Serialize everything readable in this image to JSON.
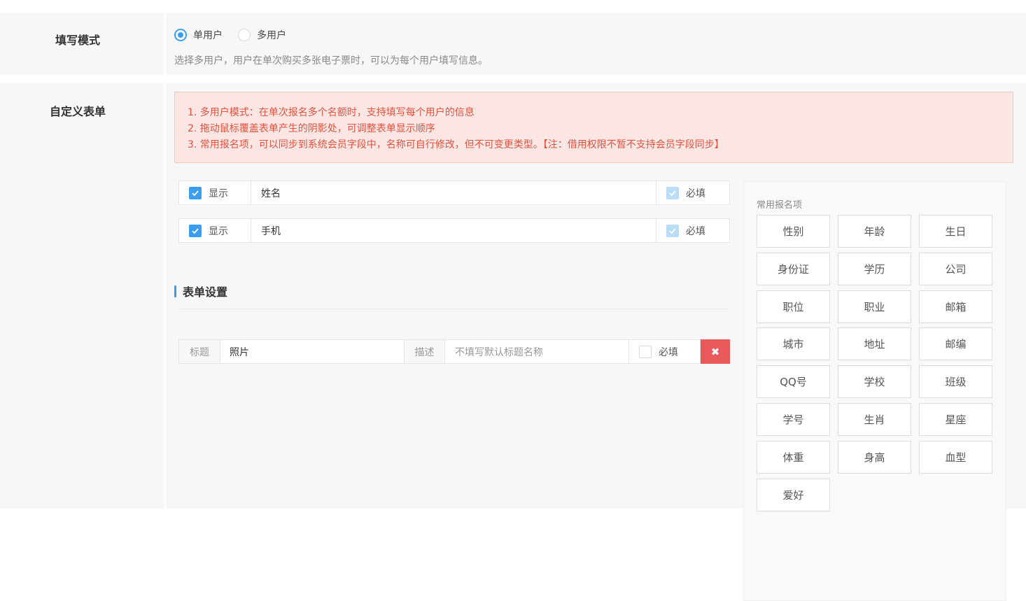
{
  "mode": {
    "label": "填写模式",
    "options": [
      {
        "label": "单用户",
        "checked": true
      },
      {
        "label": "多用户",
        "checked": false
      }
    ],
    "hint": "选择多用户，用户在单次购买多张电子票时，可以为每个用户填写信息。"
  },
  "custom_form": {
    "label": "自定义表单",
    "notice": [
      "1. 多用户模式：在单次报名多个名额时，支持填写每个用户的信息",
      "2. 拖动鼠标覆盖表单产生的阴影处，可调整表单显示顺序",
      "3. 常用报名项，可以同步到系统会员字段中，名称可自行修改，但不可变更类型。【注：借用权限不暂不支持会员字段同步】"
    ],
    "fields": [
      {
        "show_label": "显示",
        "name": "姓名",
        "required_label": "必填"
      },
      {
        "show_label": "显示",
        "name": "手机",
        "required_label": "必填"
      }
    ],
    "settings_title": "表单设置",
    "photo_row": {
      "title_addon": "标题",
      "title_value": "照片",
      "desc_addon": "描述",
      "desc_placeholder": "不填写默认标题名称",
      "required_label": "必填",
      "delete_icon": "close-icon"
    }
  },
  "common_fields": {
    "title": "常用报名项",
    "items": [
      "性别",
      "年龄",
      "生日",
      "身份证",
      "学历",
      "公司",
      "职位",
      "职业",
      "邮箱",
      "城市",
      "地址",
      "邮编",
      "QQ号",
      "学校",
      "班级",
      "学号",
      "生肖",
      "星座",
      "体重",
      "身高",
      "血型",
      "爱好"
    ]
  },
  "colors": {
    "accent": "#3a9ef0",
    "danger": "#e9595c",
    "notice_text": "#e0533f",
    "notice_bg": "#fbe6e4"
  }
}
